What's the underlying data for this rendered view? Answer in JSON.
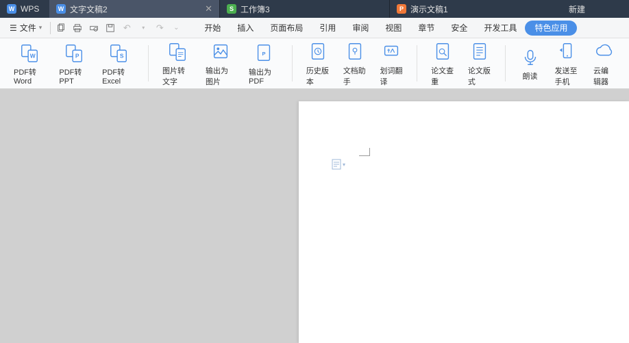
{
  "titlebar": {
    "app_label": "WPS",
    "tabs": [
      {
        "icon": "W",
        "label": "文字文稿2",
        "active": true
      },
      {
        "icon": "S",
        "label": "工作簿3",
        "active": false
      },
      {
        "icon": "P",
        "label": "演示文稿1",
        "active": false
      }
    ],
    "new_tab_label": "新建"
  },
  "menubar": {
    "file_label": "文件",
    "tabs": [
      "开始",
      "插入",
      "页面布局",
      "引用",
      "审阅",
      "视图",
      "章节",
      "安全",
      "开发工具",
      "特色应用"
    ]
  },
  "ribbon": {
    "groups": [
      {
        "items": [
          {
            "id": "pdf-to-word",
            "label": "PDF转Word"
          },
          {
            "id": "pdf-to-ppt",
            "label": "PDF转PPT"
          },
          {
            "id": "pdf-to-excel",
            "label": "PDF转Excel"
          }
        ]
      },
      {
        "items": [
          {
            "id": "img-to-text",
            "label": "图片转文字"
          },
          {
            "id": "export-img",
            "label": "输出为图片"
          },
          {
            "id": "export-pdf",
            "label": "输出为PDF"
          }
        ]
      },
      {
        "items": [
          {
            "id": "history",
            "label": "历史版本"
          },
          {
            "id": "doc-assist",
            "label": "文档助手"
          },
          {
            "id": "word-translate",
            "label": "划词翻译"
          }
        ]
      },
      {
        "items": [
          {
            "id": "thesis-check",
            "label": "论文查重"
          },
          {
            "id": "thesis-layout",
            "label": "论文版式"
          }
        ]
      },
      {
        "items": [
          {
            "id": "read-aloud",
            "label": "朗读"
          },
          {
            "id": "send-mobile",
            "label": "发送至手机"
          },
          {
            "id": "cloud-edit",
            "label": "云编辑器"
          }
        ]
      }
    ]
  }
}
